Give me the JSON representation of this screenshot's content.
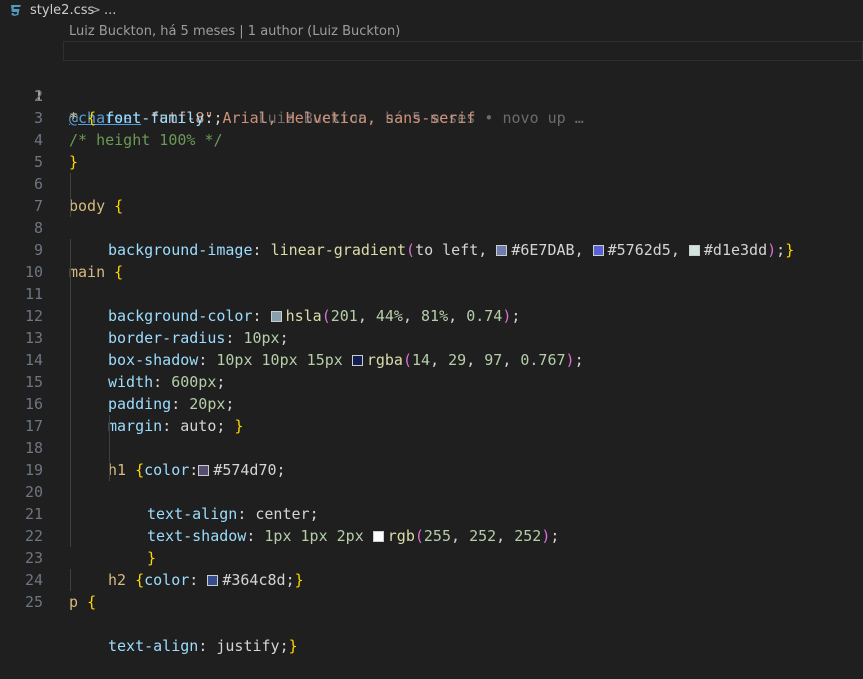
{
  "breadcrumb": {
    "file": "style2.css",
    "chevron": ">",
    "ellipsis": "..."
  },
  "codelens": "Luiz Buckton, há 5 meses | 1 author (Luiz Buckton)",
  "blame": "Luiz Buckton, há 5 meses • novo up …",
  "colors": {
    "c6E7DAB": "#6E7DAB",
    "c5762d5": "#5762d5",
    "cd1e3dd": "#d1e3dd",
    "hsla": "hsla(201, 44%, 81%, 0.74)",
    "rgba": "rgba(14, 29, 97, 0.767)",
    "c574d70": "#574d70",
    "white": "rgb(255, 252, 252)",
    "c364c8d": "#364c8d"
  },
  "lines": {
    "n1": "1",
    "n2": "2",
    "n3": "3",
    "n4": "4",
    "n5": "5",
    "n6": "6",
    "n7": "7",
    "n8": "8",
    "n9": "9",
    "n10": "10",
    "n11": "11",
    "n12": "12",
    "n13": "13",
    "n14": "14",
    "n15": "15",
    "n16": "16",
    "n17": "17",
    "n18": "18",
    "n19": "19",
    "n20": "20",
    "n21": "21",
    "n22": "22",
    "n23": "23",
    "n24": "24",
    "n25": "25"
  },
  "code": {
    "l1_kw": "@charset",
    "l1_str": "\"utf-8\"",
    "l1_semi": ";",
    "l2_sel": "*",
    "l2_brace": "{",
    "l2_prop": "font-family",
    "l2_val": "Arial, Helvetica, sans-serif",
    "l3": "/* height 100% */",
    "l4": "}",
    "l6_sel": "body",
    "l6_brace": "{",
    "l7_prop": "background-image",
    "l7_fn": "linear-gradient",
    "l7_arg": "to left, ",
    "l7_c1": "#6E7DAB",
    "l7_c2": "#5762d5",
    "l7_c3": "#d1e3dd",
    "l7_end": "}",
    "l9_sel": "main",
    "l9_brace": "{",
    "l10_prop": "background-color",
    "l10_fn": "hsla",
    "l10_n1": "201",
    "l10_n2": "44%",
    "l10_n3": "81%",
    "l10_n4": "0.74",
    "l11_prop": "border-radius",
    "l11_val": "10px",
    "l12_prop": "box-shadow",
    "l12_val": "10px 10px 15px",
    "l12_fn": "rgba",
    "l12_n1": "14",
    "l12_n2": "29",
    "l12_n3": "97",
    "l12_n4": "0.767",
    "l13_prop": "width",
    "l13_val": "600px",
    "l14_prop": "padding",
    "l14_val": "20px",
    "l15_prop": "margin",
    "l15_val": "auto",
    "l15_brace": "}",
    "l17_sel": "h1",
    "l17_brace": "{",
    "l17_prop": "color",
    "l17_val": "#574d70",
    "l18_prop": "text-align",
    "l18_val": "center",
    "l19_prop": "text-shadow",
    "l19_val": "1px 1px 2px",
    "l19_fn": "rgb",
    "l19_n1": "255",
    "l19_n2": "252",
    "l19_n3": "252",
    "l20": "}",
    "l22_sel": "h2",
    "l22_brace": "{",
    "l22_prop": "color",
    "l22_val": "#364c8d",
    "l22_end": "}",
    "l24_sel": "p",
    "l24_brace": "{",
    "l25_prop": "text-align",
    "l25_val": "justify",
    "l25_end": "}"
  }
}
